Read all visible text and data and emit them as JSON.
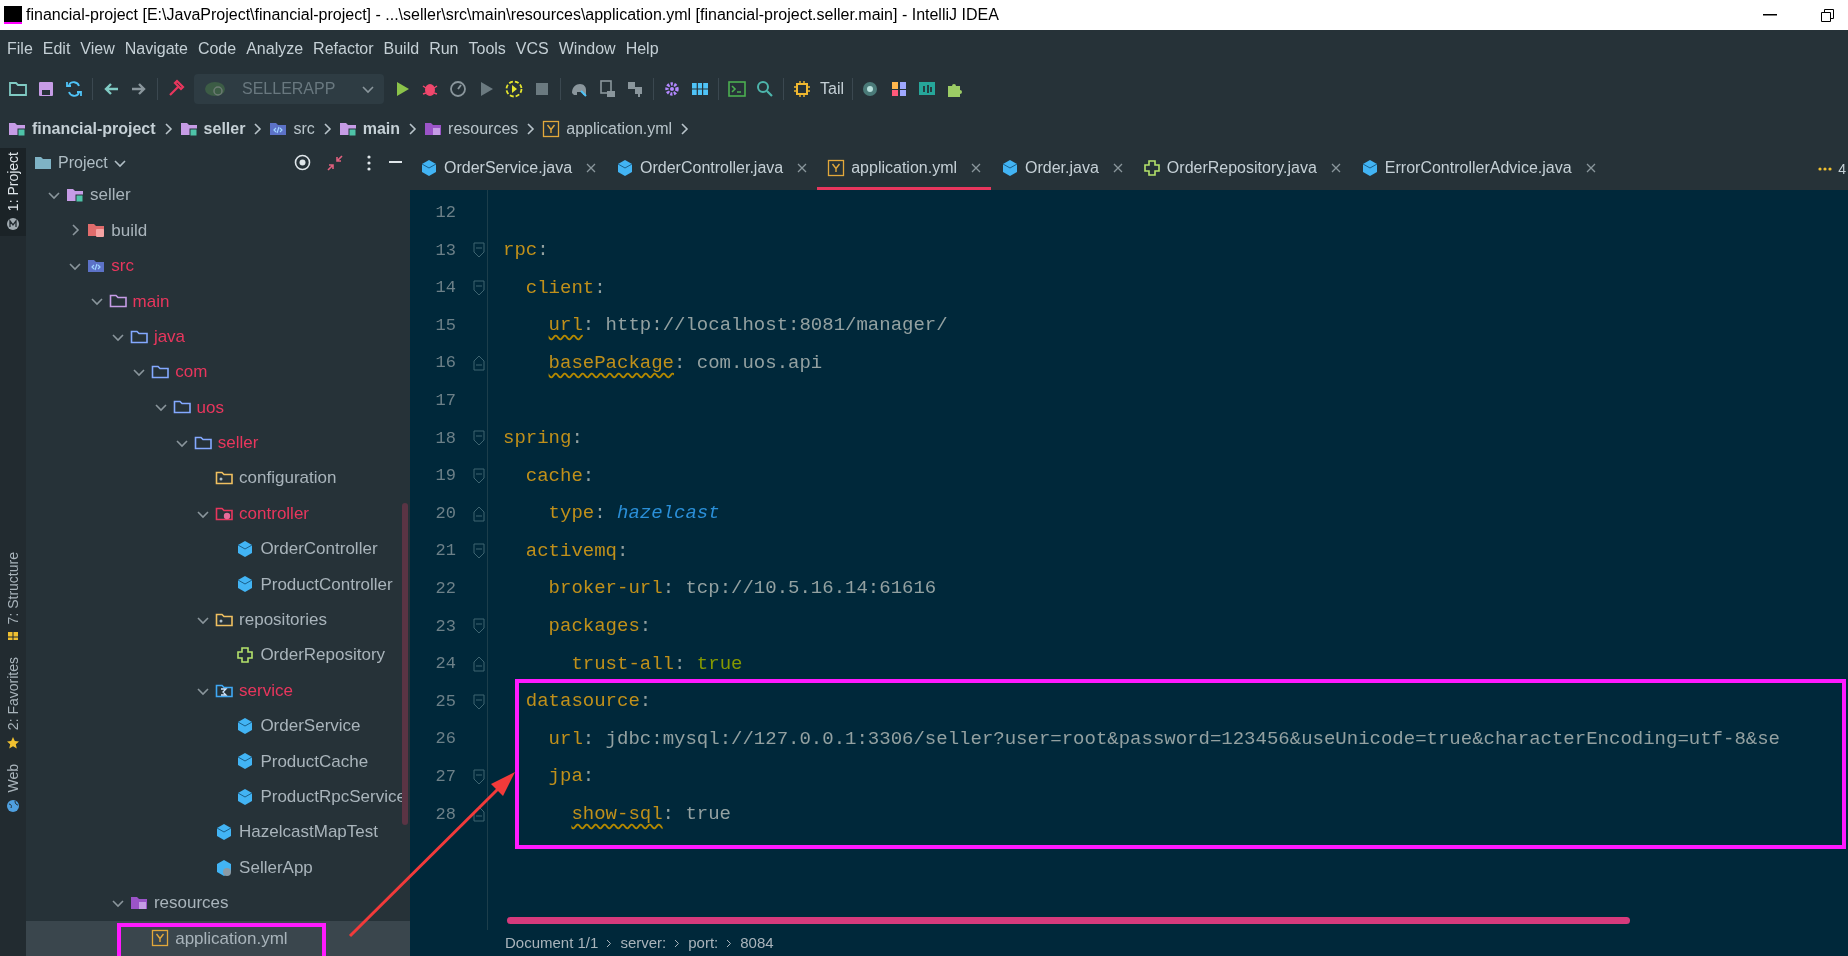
{
  "window": {
    "title": "financial-project [E:\\JavaProject\\financial-project] - ...\\seller\\src\\main\\resources\\application.yml [financial-project.seller.main] - IntelliJ IDEA"
  },
  "menu": [
    "File",
    "Edit",
    "View",
    "Navigate",
    "Code",
    "Analyze",
    "Refactor",
    "Build",
    "Run",
    "Tools",
    "VCS",
    "Window",
    "Help"
  ],
  "toolbar": {
    "run_configuration": "SELLERAPP",
    "tail_label": "Tail"
  },
  "breadcrumb": [
    {
      "label": "financial-project",
      "kind": "module",
      "bold": true
    },
    {
      "label": "seller",
      "kind": "module",
      "bold": true
    },
    {
      "label": "src",
      "kind": "source",
      "bold": false
    },
    {
      "label": "main",
      "kind": "module",
      "bold": true
    },
    {
      "label": "resources",
      "kind": "resources",
      "bold": false
    },
    {
      "label": "application.yml",
      "kind": "yaml",
      "bold": false
    }
  ],
  "side_stripe": [
    {
      "label": "1: Project",
      "selected": true,
      "kind": "project"
    },
    {
      "label": "7: Structure",
      "selected": false,
      "kind": "structure"
    },
    {
      "label": "2: Favorites",
      "selected": false,
      "kind": "favorites"
    },
    {
      "label": "Web",
      "selected": false,
      "kind": "web"
    }
  ],
  "project_panel": {
    "title": "Project",
    "tree": [
      {
        "label": "seller",
        "kind": "module",
        "expanded": true,
        "selected": false,
        "color": "#a9b4bb",
        "children": [
          {
            "label": "build",
            "kind": "excluded",
            "expanded": false,
            "selected": false,
            "color": "#a9b4bb"
          },
          {
            "label": "src",
            "kind": "source",
            "expanded": true,
            "selected": false,
            "color": "#e8365d",
            "children": [
              {
                "label": "main",
                "kind": "module-folder",
                "expanded": true,
                "selected": false,
                "color": "#e8365d",
                "children": [
                  {
                    "label": "java",
                    "kind": "folder",
                    "expanded": true,
                    "selected": false,
                    "color": "#e8365d",
                    "children": [
                      {
                        "label": "com",
                        "kind": "folder",
                        "expanded": true,
                        "selected": false,
                        "color": "#e8365d",
                        "children": [
                          {
                            "label": "uos",
                            "kind": "folder",
                            "expanded": true,
                            "selected": false,
                            "color": "#e8365d",
                            "children": [
                              {
                                "label": "seller",
                                "kind": "folder",
                                "expanded": true,
                                "selected": false,
                                "color": "#e8365d",
                                "children": [
                                  {
                                    "label": "configuration",
                                    "kind": "package",
                                    "selected": false,
                                    "color": "#a9b4bb"
                                  },
                                  {
                                    "label": "controller",
                                    "kind": "controller",
                                    "expanded": true,
                                    "selected": false,
                                    "color": "#e8365d",
                                    "children": [
                                      {
                                        "label": "OrderController",
                                        "kind": "class",
                                        "selected": false,
                                        "color": "#a9b4bb"
                                      },
                                      {
                                        "label": "ProductController",
                                        "kind": "class",
                                        "selected": false,
                                        "color": "#a9b4bb"
                                      }
                                    ]
                                  },
                                  {
                                    "label": "repositories",
                                    "kind": "package",
                                    "expanded": true,
                                    "selected": false,
                                    "color": "#a9b4bb",
                                    "children": [
                                      {
                                        "label": "OrderRepository",
                                        "kind": "repository",
                                        "selected": false,
                                        "color": "#a9b4bb"
                                      }
                                    ]
                                  },
                                  {
                                    "label": "service",
                                    "kind": "service",
                                    "expanded": true,
                                    "selected": false,
                                    "color": "#e8365d",
                                    "children": [
                                      {
                                        "label": "OrderService",
                                        "kind": "class",
                                        "selected": false,
                                        "color": "#a9b4bb"
                                      },
                                      {
                                        "label": "ProductCache",
                                        "kind": "class",
                                        "selected": false,
                                        "color": "#a9b4bb"
                                      },
                                      {
                                        "label": "ProductRpcService",
                                        "kind": "class",
                                        "selected": false,
                                        "color": "#a9b4bb"
                                      }
                                    ]
                                  },
                                  {
                                    "label": "HazelcastMapTest",
                                    "kind": "class",
                                    "selected": false,
                                    "color": "#a9b4bb"
                                  },
                                  {
                                    "label": "SellerApp",
                                    "kind": "app",
                                    "selected": false,
                                    "color": "#a9b4bb"
                                  }
                                ]
                              }
                            ]
                          }
                        ]
                      }
                    ]
                  },
                  {
                    "label": "resources",
                    "kind": "resources",
                    "expanded": true,
                    "selected": false,
                    "color": "#a9b4bb",
                    "children": [
                      {
                        "label": "application.yml",
                        "kind": "yaml",
                        "selected": true,
                        "color": "#a9b4bb"
                      }
                    ]
                  }
                ]
              }
            ]
          }
        ]
      }
    ]
  },
  "editor": {
    "tabs": [
      {
        "label": "OrderService.java",
        "kind": "class",
        "selected": false
      },
      {
        "label": "OrderController.java",
        "kind": "class",
        "selected": false
      },
      {
        "label": "application.yml",
        "kind": "yaml",
        "selected": true
      },
      {
        "label": "Order.java",
        "kind": "class",
        "selected": false
      },
      {
        "label": "OrderRepository.java",
        "kind": "repository",
        "selected": false
      },
      {
        "label": "ErrorControllerAdvice.java",
        "kind": "class",
        "selected": false
      }
    ],
    "tab_overflow": "4",
    "lines": [
      {
        "number": "12"
      },
      {
        "number": "13",
        "key": "rpc",
        "rest": ":",
        "warning": false,
        "children": [
          {
            "number": "14",
            "key": "client",
            "rest": ":",
            "warning": false,
            "children": [
              {
                "number": "15",
                "key": "url",
                "rest": ": http://localhost:8081/manager/",
                "warning": true
              },
              {
                "number": "16",
                "key": "basePackage",
                "rest": ": com.uos.api",
                "warning": true
              }
            ]
          }
        ]
      },
      {
        "number": "17"
      },
      {
        "number": "18",
        "key": "spring",
        "rest": ":",
        "warning": false,
        "children": [
          {
            "number": "19",
            "key": "cache",
            "rest": ":",
            "warning": false,
            "children": [
              {
                "number": "20",
                "key": "type",
                "rest": ": ",
                "value": "hazelcast",
                "kind": "constant",
                "warning": false
              }
            ]
          },
          {
            "number": "21",
            "key": "activemq",
            "rest": ":",
            "warning": false,
            "children": [
              {
                "number": "22",
                "key": "broker-url",
                "rest": ": tcp://10.5.16.14:61616",
                "warning": false
              },
              {
                "number": "23",
                "key": "packages",
                "rest": ":",
                "warning": false,
                "children": [
                  {
                    "number": "24",
                    "key": "trust-all",
                    "rest": ": ",
                    "value": "true",
                    "kind": "bool",
                    "warning": false
                  }
                ]
              }
            ]
          },
          {
            "number": "25",
            "key": "datasource",
            "rest": ":",
            "warning": false,
            "children": [
              {
                "number": "26",
                "key": "url",
                "rest": ": jdbc:mysql://127.0.0.1:3306/seller?user=root&password=123456&useUnicode=true&characterEncoding=utf-8&se",
                "warning": false
              },
              {
                "number": "27",
                "key": "jpa",
                "rest": ":",
                "warning": false,
                "children": [
                  {
                    "number": "28",
                    "key": "show-sql",
                    "rest": ": true",
                    "warning": true
                  }
                ]
              }
            ]
          }
        ]
      }
    ],
    "status_path": [
      "Document 1/1",
      "server:",
      "port:",
      "8084"
    ]
  }
}
